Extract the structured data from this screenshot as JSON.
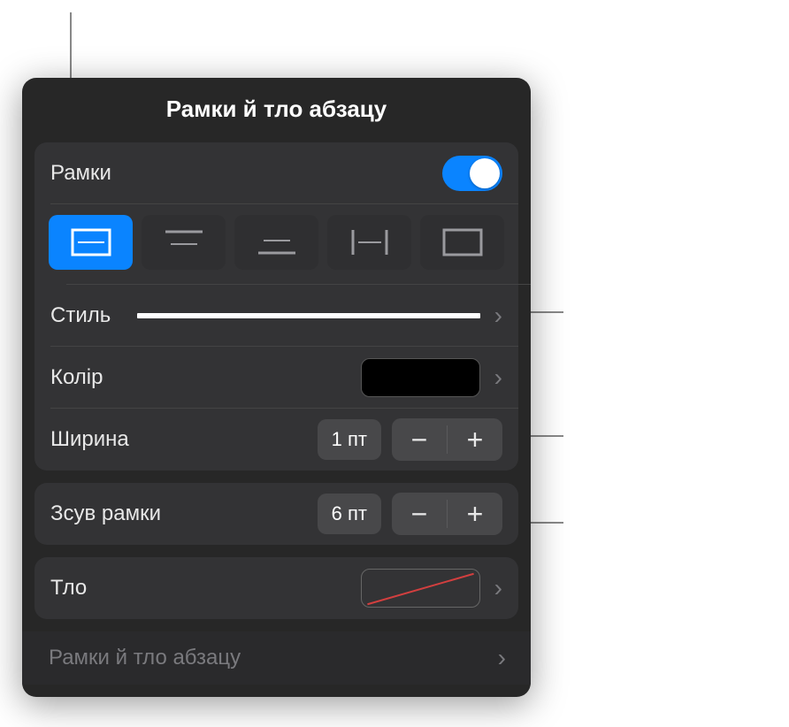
{
  "panel_title": "Рамки й тло абзацу",
  "borders": {
    "toggle_label": "Рамки",
    "toggle_on": true,
    "positions": [
      "all",
      "top",
      "bottom",
      "left",
      "right"
    ],
    "selected_position": 0,
    "style_label": "Стиль",
    "color_label": "Колір",
    "color_value": "#000000",
    "width_label": "Ширина",
    "width_value": "1 пт",
    "offset_label": "Зсув рамки",
    "offset_value": "6 пт"
  },
  "background": {
    "label": "Тло",
    "value": "none"
  },
  "footer_link": "Рамки й тло абзацу"
}
